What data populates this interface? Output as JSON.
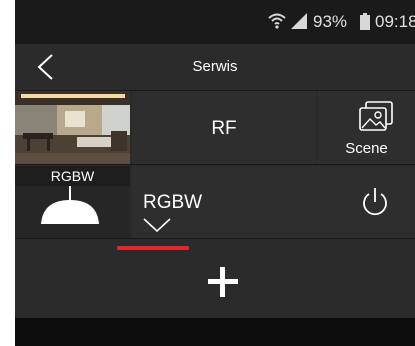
{
  "status_bar": {
    "battery_percent": "93%",
    "time": "09:18",
    "icons": [
      "wifi-icon",
      "signal-icon",
      "battery-icon"
    ]
  },
  "app_bar": {
    "title": "Serwis",
    "back_icon": "chevron-left-icon"
  },
  "row1": {
    "rf_label": "RF",
    "scene_label": "Scene",
    "scene_icon": "scene-images-icon"
  },
  "row2": {
    "lamp_label": "RGBW",
    "device_label": "RGBW",
    "dropdown_icon": "chevron-down-icon",
    "power_icon": "power-icon"
  },
  "add": {
    "icon": "plus-icon"
  },
  "colors": {
    "accent": "#e0262a",
    "background": "#2a2a2a",
    "tile": "#2e2e2e",
    "text": "#ffffff"
  }
}
